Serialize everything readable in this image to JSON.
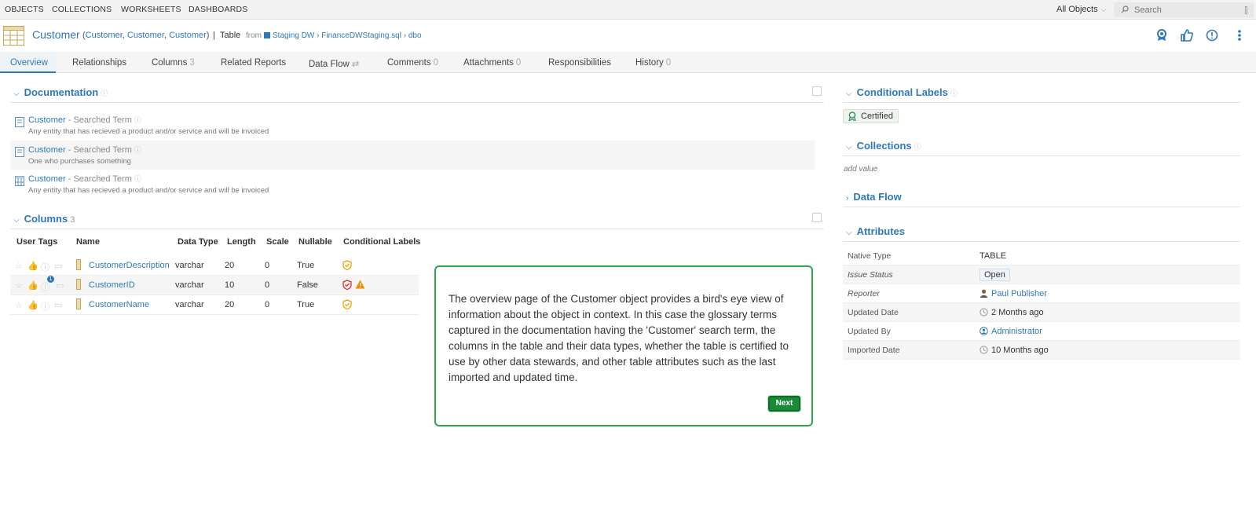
{
  "topnav": {
    "items": [
      "OBJECTS",
      "COLLECTIONS",
      "WORKSHEETS",
      "DASHBOARDS"
    ],
    "scope_label": "All Objects",
    "search_placeholder": "Search"
  },
  "object": {
    "title": "Customer",
    "aliases_open": "(",
    "aliases": [
      "Customer",
      "Customer",
      "Customer"
    ],
    "aliases_close": ")",
    "separator": "|",
    "type": "Table",
    "from_label": "from",
    "path": "Staging DW › FinanceDWStaging.sql › dbo"
  },
  "header_icons": [
    "certified-icon",
    "endorse-icon",
    "warning-icon",
    "more-icon"
  ],
  "tabs": [
    {
      "label": "Overview",
      "count": ""
    },
    {
      "label": "Relationships",
      "count": ""
    },
    {
      "label": "Columns",
      "count": "3"
    },
    {
      "label": "Related Reports",
      "count": ""
    },
    {
      "label": "Data Flow",
      "count": "⇄"
    },
    {
      "label": "Comments",
      "count": "0"
    },
    {
      "label": "Attachments",
      "count": "0"
    },
    {
      "label": "Responsibilities",
      "count": ""
    },
    {
      "label": "History",
      "count": "0"
    }
  ],
  "documentation": {
    "heading": "Documentation",
    "items": [
      {
        "term": "Customer",
        "sub": " - Searched Term",
        "desc": "Any entity that has recieved a product and/or service and will be invoiced"
      },
      {
        "term": "Customer",
        "sub": " - Searched Term",
        "desc": "One who purchases something"
      },
      {
        "term": "Customer",
        "sub": " - Searched Term",
        "desc": "Any entity that has recieved a product and/or service and will be invoiced"
      }
    ]
  },
  "columns": {
    "heading": "Columns",
    "count": "3",
    "headers": [
      "User Tags",
      "Name",
      "Data Type",
      "Length",
      "Scale",
      "Nullable",
      "Conditional Labels"
    ],
    "rows": [
      {
        "name": "CustomerDescription",
        "type": "varchar",
        "length": "20",
        "scale": "0",
        "nullable": "True"
      },
      {
        "name": "CustomerID",
        "type": "varchar",
        "length": "10",
        "scale": "0",
        "nullable": "False",
        "comment_count": "1"
      },
      {
        "name": "CustomerName",
        "type": "varchar",
        "length": "20",
        "scale": "0",
        "nullable": "True"
      }
    ]
  },
  "tour": {
    "text": "The overview page of the Customer object provides a bird's eye view of information about the object in context. In this case the glossary terms captured in the documentation having the 'Customer' search term, the columns in the table and their data types, whether the table is certified to use by other data stewards, and other table attributes such as the last imported and updated time.",
    "next_label": "Next"
  },
  "right": {
    "conditional_labels": {
      "heading": "Conditional Labels",
      "badge": "Certified"
    },
    "collections": {
      "heading": "Collections",
      "placeholder": "add value"
    },
    "data_flow": {
      "heading": "Data Flow"
    },
    "attributes": {
      "heading": "Attributes",
      "rows": [
        {
          "key": "Native Type",
          "value": "TABLE"
        },
        {
          "key": "Issue Status",
          "value": "Open"
        },
        {
          "key": "Reporter",
          "value": "Paul Publisher"
        },
        {
          "key": "Updated Date",
          "value": "2 Months ago"
        },
        {
          "key": "Updated By",
          "value": "Administrator"
        },
        {
          "key": "Imported Date",
          "value": "10 Months ago"
        }
      ]
    }
  },
  "colors": {
    "accent": "#2f78b8",
    "tour_border": "#2ea44f",
    "next_bg": "#1a8a3a",
    "warn": "#f08c00"
  }
}
